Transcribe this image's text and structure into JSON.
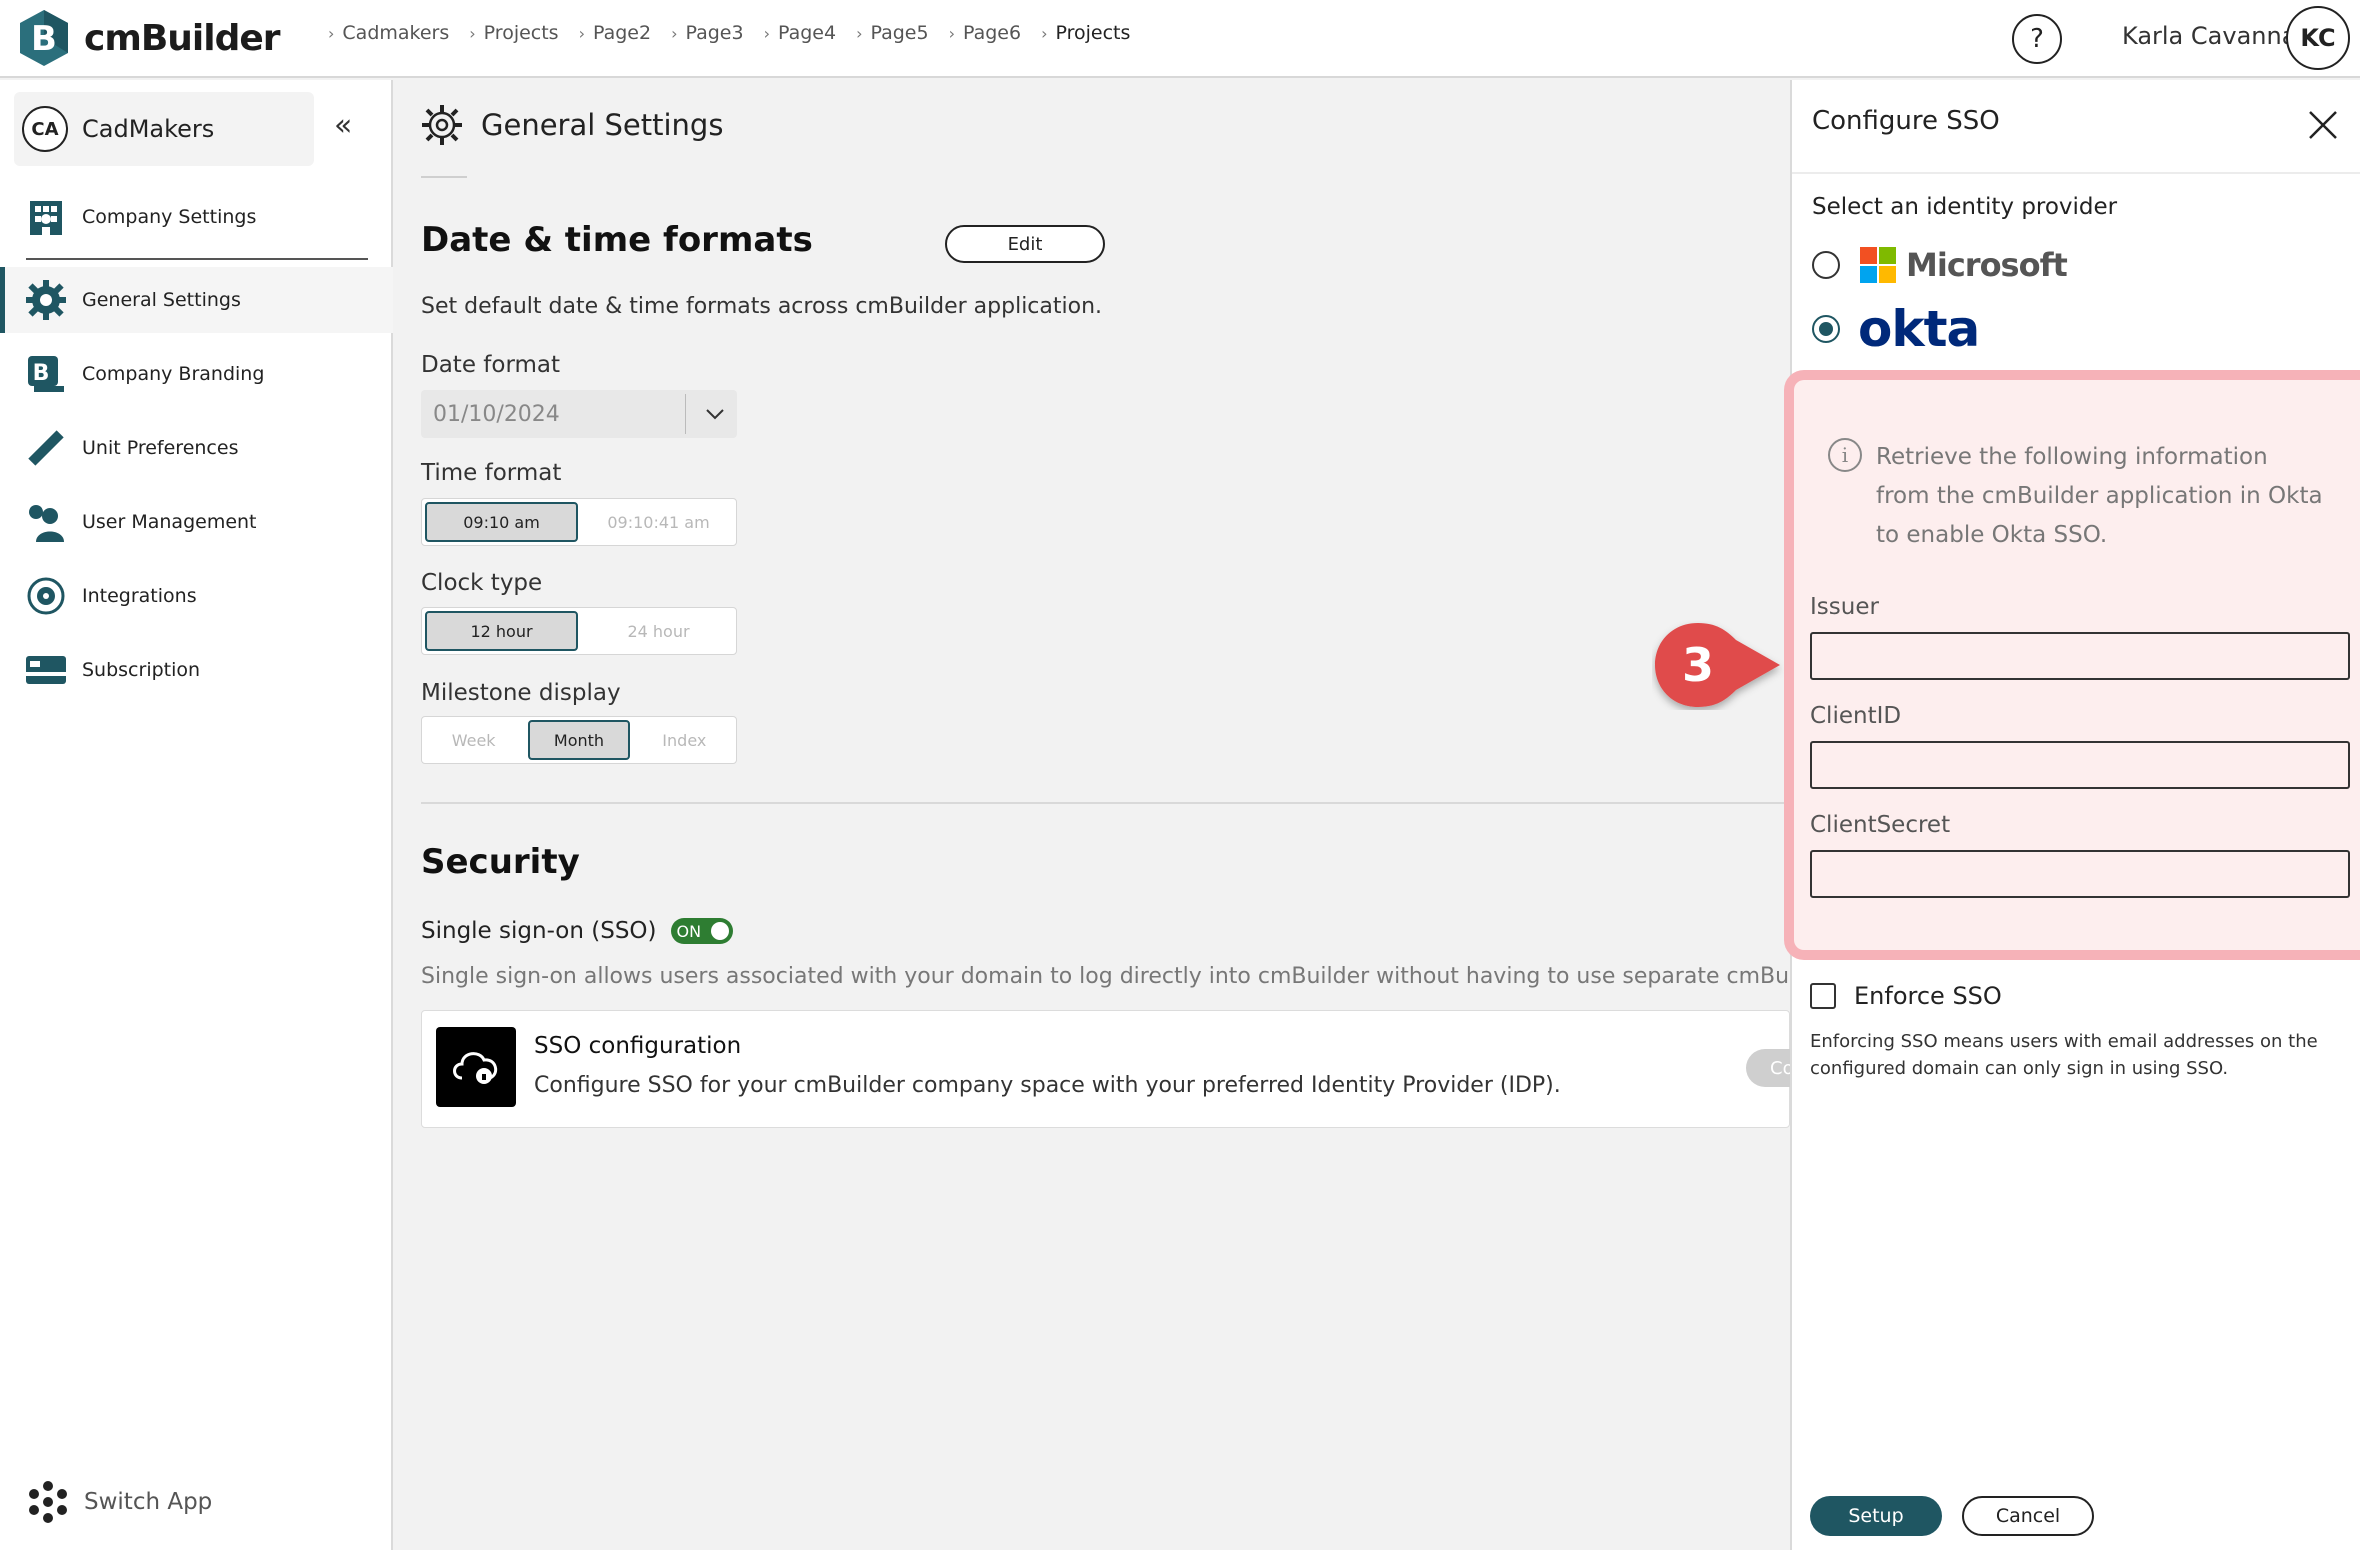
{
  "app": {
    "brand": "cmBuilder",
    "brand_color": "#1f5662"
  },
  "breadcrumb": [
    "Cadmakers",
    "Projects",
    "Page2",
    "Page3",
    "Page4",
    "Page5",
    "Page6",
    "Projects"
  ],
  "user": {
    "name": "Karla Cavanna",
    "initials": "KC"
  },
  "help_label": "?",
  "sidebar": {
    "company_initials": "CA",
    "company_name": "CadMakers",
    "collapse_icon": "«",
    "header_item": "Company Settings",
    "items": [
      {
        "label": "General Settings",
        "icon": "gear-icon",
        "active": true
      },
      {
        "label": "Company Branding",
        "icon": "branding-icon"
      },
      {
        "label": "Unit Preferences",
        "icon": "ruler-icon"
      },
      {
        "label": "User Management",
        "icon": "users-icon"
      },
      {
        "label": "Integrations",
        "icon": "integrations-icon"
      },
      {
        "label": "Subscription",
        "icon": "card-icon"
      }
    ],
    "switch_app": "Switch App"
  },
  "main": {
    "title": "General Settings",
    "datetime": {
      "heading": "Date & time formats",
      "edit_label": "Edit",
      "description": "Set default date & time formats across cmBuilder application.",
      "date_format_label": "Date format",
      "date_format_value": "01/10/2024",
      "time_format_label": "Time format",
      "time_options": [
        "09:10 am",
        "09:10:41 am"
      ],
      "clock_type_label": "Clock type",
      "clock_options": [
        "12 hour",
        "24 hour"
      ],
      "milestone_label": "Milestone display",
      "milestone_options": [
        "Week",
        "Month",
        "Index"
      ]
    },
    "security": {
      "heading": "Security",
      "sso_label": "Single sign-on (SSO)",
      "sso_toggle": "ON",
      "sso_description": "Single sign-on allows users associated with your domain to log directly into cmBuilder without having to use separate cmBuilder cr",
      "card_title": "SSO configuration",
      "card_desc": "Configure SSO for your cmBuilder company space with your preferred Identity Provider (IDP).",
      "card_button": "Co"
    }
  },
  "panel": {
    "title": "Configure SSO",
    "subtitle": "Select an identity provider",
    "providers": [
      {
        "name": "Microsoft",
        "checked": false
      },
      {
        "name": "okta",
        "checked": true
      }
    ],
    "info": "Retrieve the following information from the cmBuilder application in Okta to enable Okta SSO.",
    "fields": [
      {
        "label": "Issuer",
        "value": ""
      },
      {
        "label": "ClientID",
        "value": ""
      },
      {
        "label": "ClientSecret",
        "value": ""
      }
    ],
    "enforce_label": "Enforce SSO",
    "enforce_desc": "Enforcing SSO means users with email addresses on the configured domain can only sign in using SSO.",
    "setup_label": "Setup",
    "cancel_label": "Cancel"
  },
  "callout": {
    "number": "3",
    "color": "#e04b4b"
  }
}
